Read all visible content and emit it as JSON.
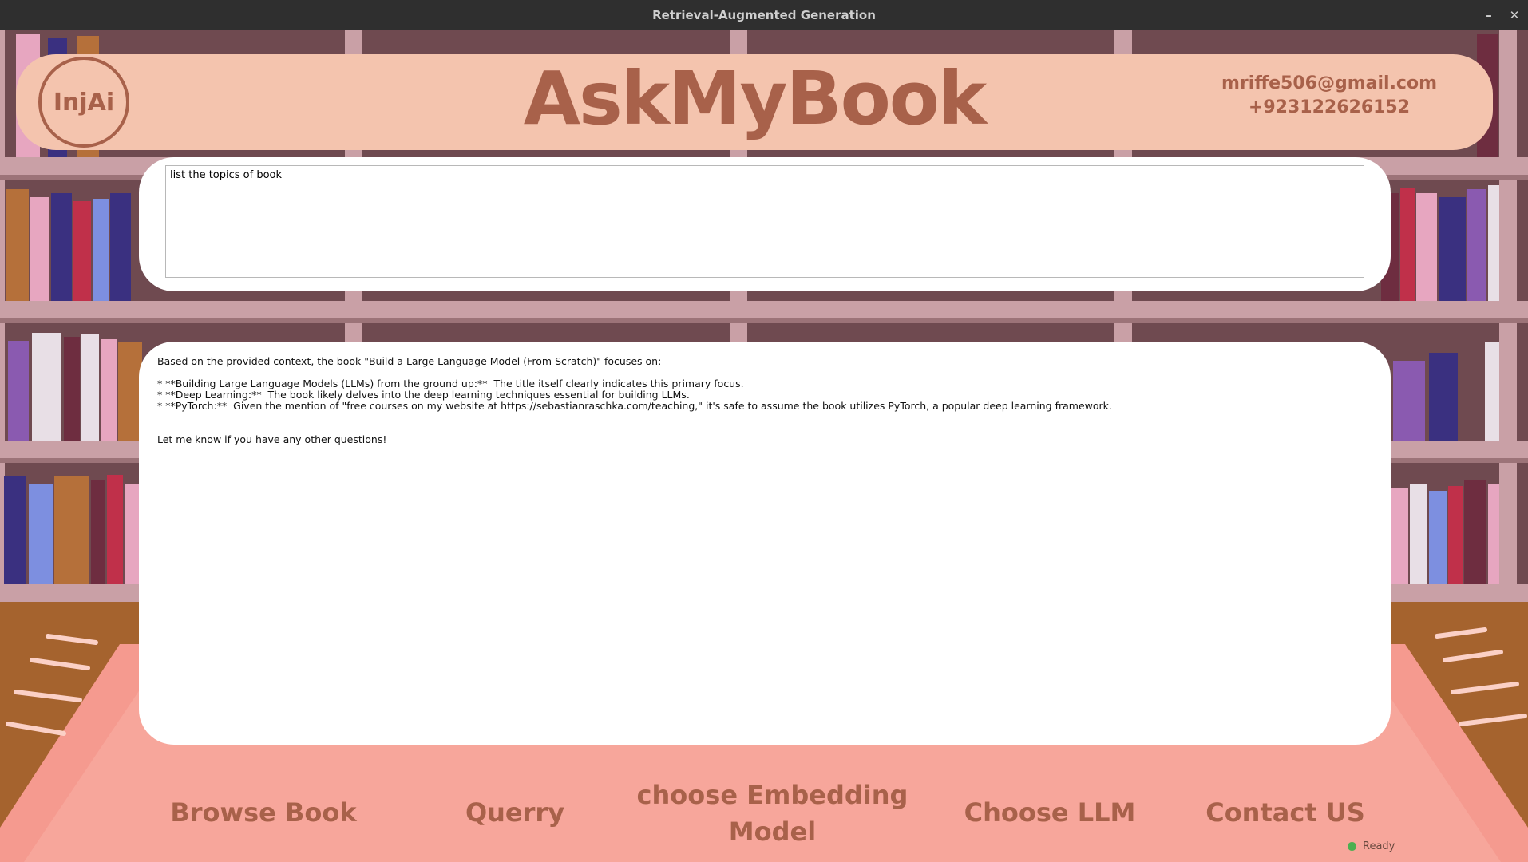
{
  "window": {
    "title": "Retrieval-Augmented Generation",
    "minimize": "–",
    "close": "✕"
  },
  "header": {
    "logo": "InjAi",
    "title": "AskMyBook",
    "email": "mriffe506@gmail.com",
    "phone": "+923122626152"
  },
  "query": {
    "value": "list the topics of book"
  },
  "answer": {
    "intro": "Based on the provided context, the book \"Build a Large Language Model (From Scratch)\" focuses on:",
    "bullets": [
      "* **Building Large Language Models (LLMs) from the ground up:**  The title itself clearly indicates this primary focus.",
      "* **Deep Learning:**  The book likely delves into the deep learning techniques essential for building LLMs.",
      "* **PyTorch:**  Given the mention of \"free courses on my website at https://sebastianraschka.com/teaching,\" it's safe to assume the book utilizes PyTorch, a popular deep learning framework."
    ],
    "closing": "Let me know if you have any other questions!"
  },
  "nav": {
    "browse": "Browse Book",
    "query": "Querry",
    "embedding_line1": "choose Embedding",
    "embedding_line2": "Model",
    "llm": "Choose LLM",
    "contact": "Contact US"
  },
  "status": {
    "text": "Ready",
    "color": "#4caf50"
  },
  "colors": {
    "accent": "#a8614a",
    "banner": "#f4c4ae"
  }
}
